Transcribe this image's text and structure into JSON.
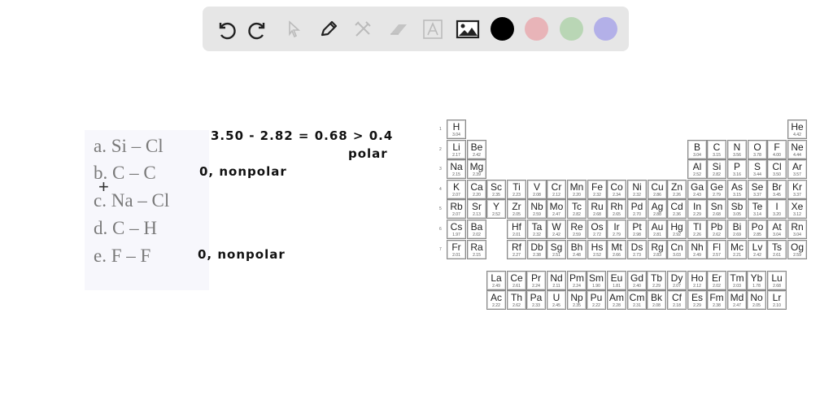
{
  "toolbar": {
    "tools": [
      "undo-icon",
      "redo-icon",
      "select-icon",
      "pen-icon",
      "tools-icon",
      "eraser-icon",
      "text-icon",
      "image-icon"
    ],
    "colors": [
      "#000000",
      "#e8b4b8",
      "#b9d6b5",
      "#b3b0e8"
    ]
  },
  "questions": [
    {
      "label": "a. Si – Cl"
    },
    {
      "label": "b. C – C"
    },
    {
      "label": "c. Na – Cl"
    },
    {
      "label": "d. C – H"
    },
    {
      "label": "e. F – F"
    }
  ],
  "handwriting": {
    "calc": "3.50 - 2.82 = 0.68 > 0.4",
    "calc_result": "polar",
    "b_answer": "0, nonpolar",
    "e_answer": "0, nonpolar"
  },
  "periodic_table": {
    "period_labels": [
      "1",
      "2",
      "3",
      "4",
      "5",
      "6",
      "7"
    ],
    "periods": [
      [
        [
          "H",
          "3.04",
          1
        ],
        [
          "He",
          "4.42",
          18
        ]
      ],
      [
        [
          "Li",
          "2.17",
          1
        ],
        [
          "Be",
          "2.42",
          2
        ],
        [
          "B",
          "3.04",
          13
        ],
        [
          "C",
          "3.15",
          14
        ],
        [
          "N",
          "3.56",
          15
        ],
        [
          "O",
          "3.78",
          16
        ],
        [
          "F",
          "4.00",
          17
        ],
        [
          "Ne",
          "4.44",
          18
        ]
      ],
      [
        [
          "Na",
          "2.15",
          1
        ],
        [
          "Mg",
          "2.39",
          2
        ],
        [
          "Al",
          "2.52",
          13
        ],
        [
          "Si",
          "2.82",
          14
        ],
        [
          "P",
          "3.16",
          15
        ],
        [
          "S",
          "3.44",
          16
        ],
        [
          "Cl",
          "3.50",
          17
        ],
        [
          "Ar",
          "3.57",
          18
        ]
      ],
      [
        [
          "K",
          "2.07",
          1
        ],
        [
          "Ca",
          "2.20",
          2
        ],
        [
          "Sc",
          "2.35",
          3
        ],
        [
          "Ti",
          "2.23",
          4
        ],
        [
          "V",
          "2.08",
          5
        ],
        [
          "Cr",
          "2.12",
          6
        ],
        [
          "Mn",
          "2.20",
          7
        ],
        [
          "Fe",
          "2.32",
          8
        ],
        [
          "Co",
          "2.34",
          9
        ],
        [
          "Ni",
          "2.32",
          10
        ],
        [
          "Cu",
          "2.86",
          11
        ],
        [
          "Zn",
          "2.26",
          12
        ],
        [
          "Ga",
          "2.43",
          13
        ],
        [
          "Ge",
          "2.79",
          14
        ],
        [
          "As",
          "3.15",
          15
        ],
        [
          "Se",
          "3.37",
          16
        ],
        [
          "Br",
          "3.45",
          17
        ],
        [
          "Kr",
          "3.37",
          18
        ]
      ],
      [
        [
          "Rb",
          "2.07",
          1
        ],
        [
          "Sr",
          "2.13",
          2
        ],
        [
          "Y",
          "2.52",
          3
        ],
        [
          "Zr",
          "2.05",
          4
        ],
        [
          "Nb",
          "2.59",
          5
        ],
        [
          "Mo",
          "2.47",
          6
        ],
        [
          "Tc",
          "2.82",
          7
        ],
        [
          "Ru",
          "2.68",
          8
        ],
        [
          "Rh",
          "2.65",
          9
        ],
        [
          "Pd",
          "2.70",
          10
        ],
        [
          "Ag",
          "2.88",
          11
        ],
        [
          "Cd",
          "2.36",
          12
        ],
        [
          "In",
          "2.29",
          13
        ],
        [
          "Sn",
          "2.68",
          14
        ],
        [
          "Sb",
          "3.05",
          15
        ],
        [
          "Te",
          "3.14",
          16
        ],
        [
          "I",
          "3.20",
          17
        ],
        [
          "Xe",
          "3.12",
          18
        ]
      ],
      [
        [
          "Cs",
          "1.97",
          1
        ],
        [
          "Ba",
          "2.02",
          2
        ],
        [
          "Hf",
          "2.01",
          4
        ],
        [
          "Ta",
          "2.32",
          5
        ],
        [
          "W",
          "2.42",
          6
        ],
        [
          "Re",
          "2.59",
          7
        ],
        [
          "Os",
          "2.72",
          8
        ],
        [
          "Ir",
          "2.79",
          9
        ],
        [
          "Pt",
          "2.98",
          10
        ],
        [
          "Au",
          "2.81",
          11
        ],
        [
          "Hg",
          "2.92",
          12
        ],
        [
          "Tl",
          "2.26",
          13
        ],
        [
          "Pb",
          "2.62",
          14
        ],
        [
          "Bi",
          "2.69",
          15
        ],
        [
          "Po",
          "2.85",
          16
        ],
        [
          "At",
          "3.04",
          17
        ],
        [
          "Rn",
          "3.04",
          18
        ]
      ],
      [
        [
          "Fr",
          "2.01",
          1
        ],
        [
          "Ra",
          "2.15",
          2
        ],
        [
          "Rf",
          "2.27",
          4
        ],
        [
          "Db",
          "2.38",
          5
        ],
        [
          "Sg",
          "2.51",
          6
        ],
        [
          "Bh",
          "2.48",
          7
        ],
        [
          "Hs",
          "2.52",
          8
        ],
        [
          "Mt",
          "2.66",
          9
        ],
        [
          "Ds",
          "2.73",
          10
        ],
        [
          "Rg",
          "2.83",
          11
        ],
        [
          "Cn",
          "3.03",
          12
        ],
        [
          "Nh",
          "2.49",
          13
        ],
        [
          "Fl",
          "2.57",
          14
        ],
        [
          "Mc",
          "2.21",
          15
        ],
        [
          "Lv",
          "2.42",
          16
        ],
        [
          "Ts",
          "2.61",
          17
        ],
        [
          "Og",
          "2.59",
          18
        ]
      ]
    ],
    "lanthanides": [
      [
        "La",
        "2.49"
      ],
      [
        "Ce",
        "2.61"
      ],
      [
        "Pr",
        "2.24"
      ],
      [
        "Nd",
        "2.11"
      ],
      [
        "Pm",
        "2.24"
      ],
      [
        "Sm",
        "1.90"
      ],
      [
        "Eu",
        "1.81"
      ],
      [
        "Gd",
        "2.40"
      ],
      [
        "Tb",
        "2.29"
      ],
      [
        "Dy",
        "2.07"
      ],
      [
        "Ho",
        "2.12"
      ],
      [
        "Er",
        "2.02"
      ],
      [
        "Tm",
        "2.03"
      ],
      [
        "Yb",
        "1.78"
      ],
      [
        "Lu",
        "2.68"
      ]
    ],
    "actinides": [
      [
        "Ac",
        "2.22"
      ],
      [
        "Th",
        "2.62"
      ],
      [
        "Pa",
        "2.33"
      ],
      [
        "U",
        "2.45"
      ],
      [
        "Np",
        "2.35"
      ],
      [
        "Pu",
        "2.22"
      ],
      [
        "Am",
        "2.28"
      ],
      [
        "Cm",
        "2.31"
      ],
      [
        "Bk",
        "2.08"
      ],
      [
        "Cf",
        "2.18"
      ],
      [
        "Es",
        "2.29"
      ],
      [
        "Fm",
        "2.38"
      ],
      [
        "Md",
        "2.47"
      ],
      [
        "No",
        "2.05"
      ],
      [
        "Lr",
        "2.10"
      ]
    ]
  }
}
